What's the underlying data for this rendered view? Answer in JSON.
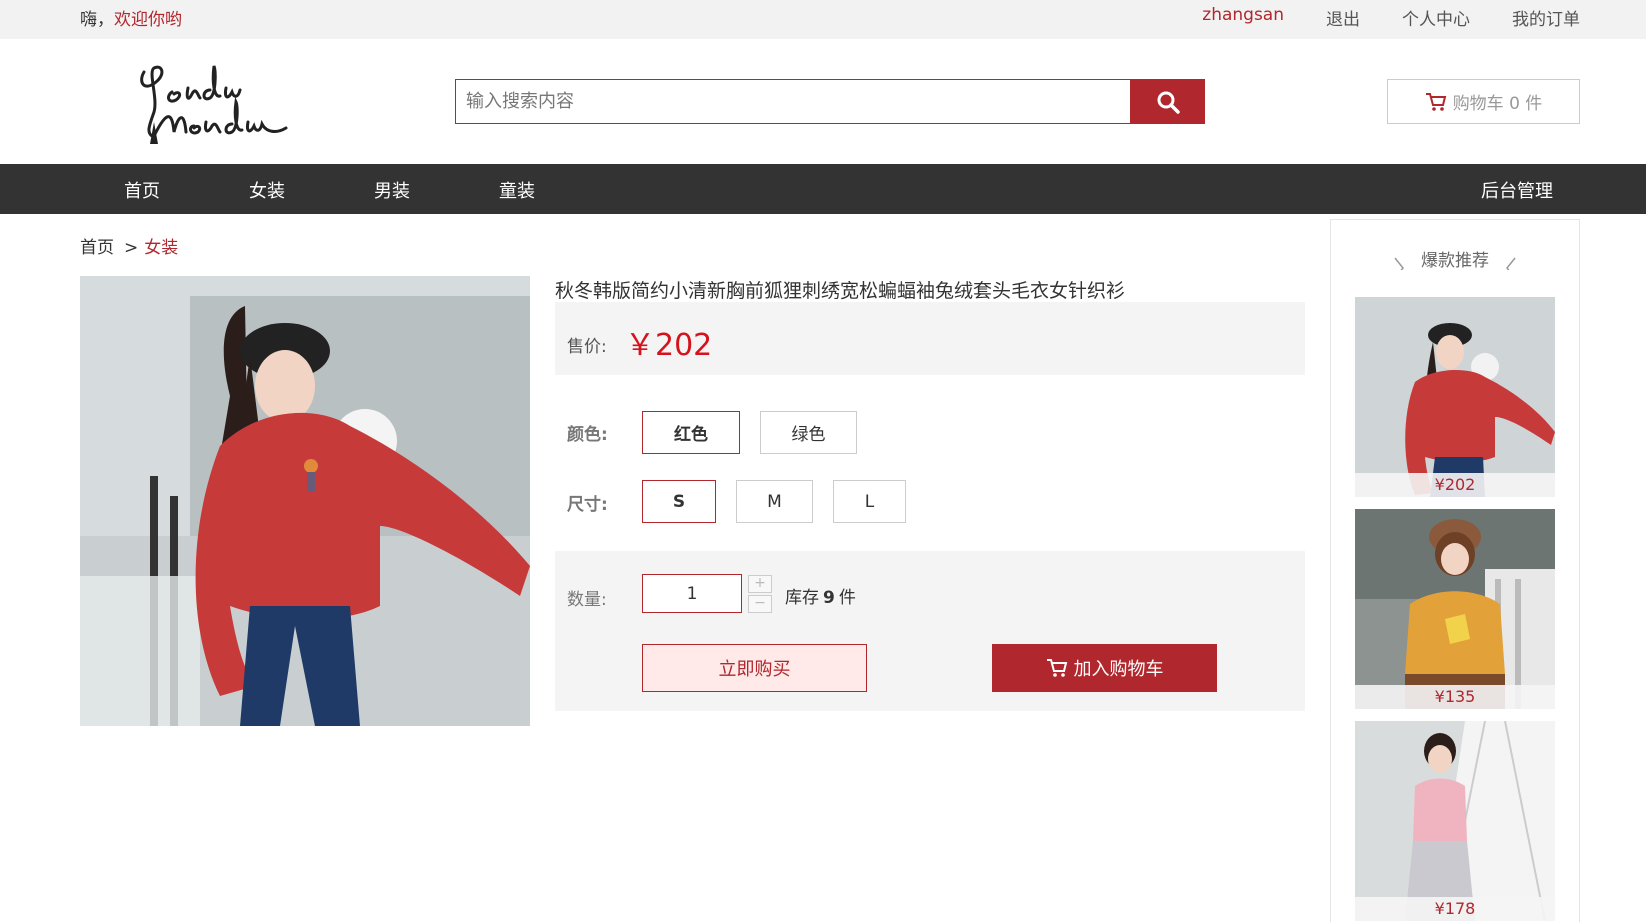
{
  "topbar": {
    "greeting": "嗨，",
    "welcome": "欢迎你哟",
    "username": "zhangsan",
    "logout": "退出",
    "profile": "个人中心",
    "orders": "我的订单"
  },
  "header": {
    "logo_text": "Vendu Mendu",
    "search_placeholder": "输入搜索内容",
    "cart_label": "购物车 0 件"
  },
  "nav": {
    "items": [
      "首页",
      "女装",
      "男装",
      "童装"
    ],
    "admin": "后台管理"
  },
  "breadcrumb": {
    "home": "首页",
    "separator": ">",
    "current": "女装"
  },
  "product": {
    "title": "秋冬韩版简约小清新胸前狐狸刺绣宽松蝙蝠袖兔绒套头毛衣女针织衫",
    "price_label": "售价:",
    "price": "￥202",
    "color_label": "颜色:",
    "colors": [
      "红色",
      "绿色"
    ],
    "size_label": "尺寸:",
    "sizes": [
      "S",
      "M",
      "L"
    ],
    "qty_label": "数量:",
    "qty": "1",
    "stock_prefix": "库存",
    "stock": "9",
    "stock_suffix": "件",
    "buy_now": "立即购买",
    "add_to_cart": "加入购物车"
  },
  "sidebar": {
    "title": "爆款推荐",
    "items": [
      {
        "price": "¥202"
      },
      {
        "price": "¥135"
      },
      {
        "price": "¥178"
      }
    ]
  },
  "colors": {
    "accent": "#b0272d",
    "price": "#d4131d",
    "nav_bg": "#333333"
  }
}
